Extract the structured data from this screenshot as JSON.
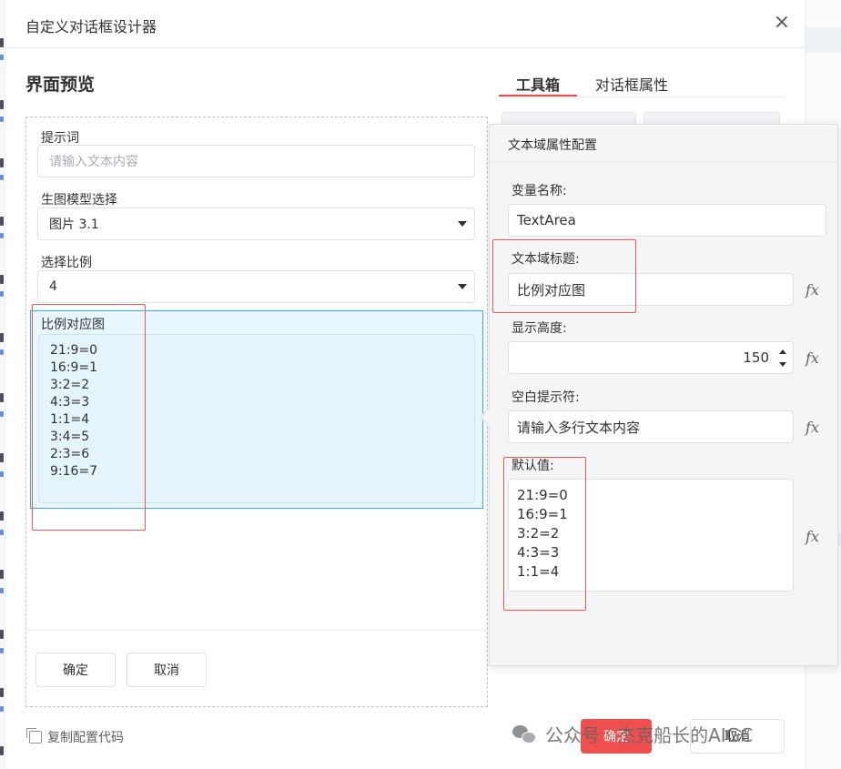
{
  "dialog": {
    "title": "自定义对话框设计器",
    "close_glyph": "×"
  },
  "preview": {
    "heading": "界面预览",
    "fields": {
      "prompt_label": "提示词",
      "prompt_placeholder": "请输入文本内容",
      "model_label": "生图模型选择",
      "model_value": "图片 3.1",
      "ratio_label": "选择比例",
      "ratio_value": "4",
      "ratio_map_label": "比例对应图",
      "ratio_map_lines": [
        "21:9=0",
        "16:9=1",
        "3:2=2",
        "4:3=3",
        "1:1=4",
        "3:4=5",
        "2:3=6",
        "9:16=7"
      ]
    },
    "ok_label": "确定",
    "cancel_label": "取消"
  },
  "tabs": [
    {
      "label": "工具箱",
      "active": true
    },
    {
      "label": "对话框属性",
      "active": false
    }
  ],
  "popover": {
    "title": "文本域属性配置",
    "var_name_label": "变量名称:",
    "var_name_value": "TextArea",
    "textarea_title_label": "文本域标题:",
    "textarea_title_value": "比例对应图",
    "height_label": "显示高度:",
    "height_value": "150",
    "placeholder_label": "空白提示符:",
    "placeholder_value": "请输入多行文本内容",
    "default_label": "默认值:",
    "default_lines": [
      "21:9=0",
      "16:9=1",
      "3:2=2",
      "4:3=3",
      "1:1=4"
    ],
    "fx_label": "fx"
  },
  "footer": {
    "copy_config_label": "复制配置代码",
    "ok_label": "确定",
    "cancel_label": "取消"
  },
  "watermark": {
    "text": "公众号 · 杰克船长的AIGC"
  },
  "colors": {
    "primary_red": "#f04f4f",
    "annotation_red": "#ef5757",
    "selected_blue": "#3bb1e3",
    "selected_bg": "#e8f6fd"
  }
}
